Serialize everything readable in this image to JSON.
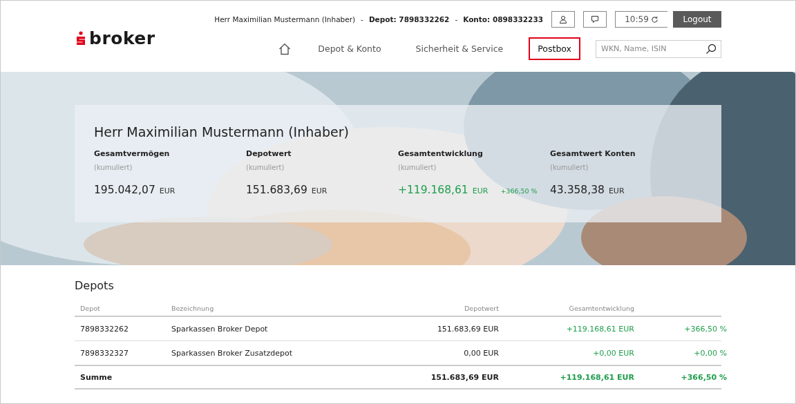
{
  "logo": {
    "text": "broker"
  },
  "account_bar": {
    "holder": "Herr Maximilian Mustermann (Inhaber)",
    "separator": "-",
    "depot": "Depot: 7898332262",
    "konto": "Konto: 0898332233",
    "time": "10:59",
    "logout": "Logout"
  },
  "nav": [
    {
      "label": "Depot & Konto",
      "highlighted": false
    },
    {
      "label": "Sicherheit & Service",
      "highlighted": false
    },
    {
      "label": "Postbox",
      "highlighted": true
    }
  ],
  "search": {
    "placeholder": "WKN, Name, ISIN"
  },
  "summary": {
    "title": "Herr Maximilian Mustermann (Inhaber)",
    "stats": [
      {
        "label": "Gesamtvermögen",
        "sub": "(kumuliert)",
        "value": "195.042,07",
        "unit": "EUR",
        "positive": false
      },
      {
        "label": "Depotwert",
        "sub": "(kumuliert)",
        "value": "151.683,69",
        "unit": "EUR",
        "positive": false
      },
      {
        "label": "Gesamtentwicklung",
        "sub": "(kumuliert)",
        "value": "+119.168,61",
        "unit": "EUR",
        "change": "+366,50 %",
        "positive": true
      },
      {
        "label": "Gesamtwert Konten",
        "sub": "(kumuliert)",
        "value": "43.358,38",
        "unit": "EUR",
        "positive": false
      }
    ]
  },
  "depots": {
    "title": "Depots",
    "columns": [
      "Depot",
      "Bezeichnung",
      "Depotwert",
      "Gesamtentwicklung"
    ],
    "rows": [
      {
        "depot": "7898332262",
        "name": "Sparkassen Broker Depot",
        "value": "151.683,69 EUR",
        "change": "+119.168,61 EUR",
        "percent": "+366,50 %"
      },
      {
        "depot": "7898332327",
        "name": "Sparkassen Broker Zusatzdepot",
        "value": "0,00 EUR",
        "change": "+0,00 EUR",
        "percent": "+0,00 %"
      }
    ],
    "total": {
      "label": "Summe",
      "value": "151.683,69 EUR",
      "change": "+119.168,61 EUR",
      "percent": "+366,50 %"
    }
  }
}
